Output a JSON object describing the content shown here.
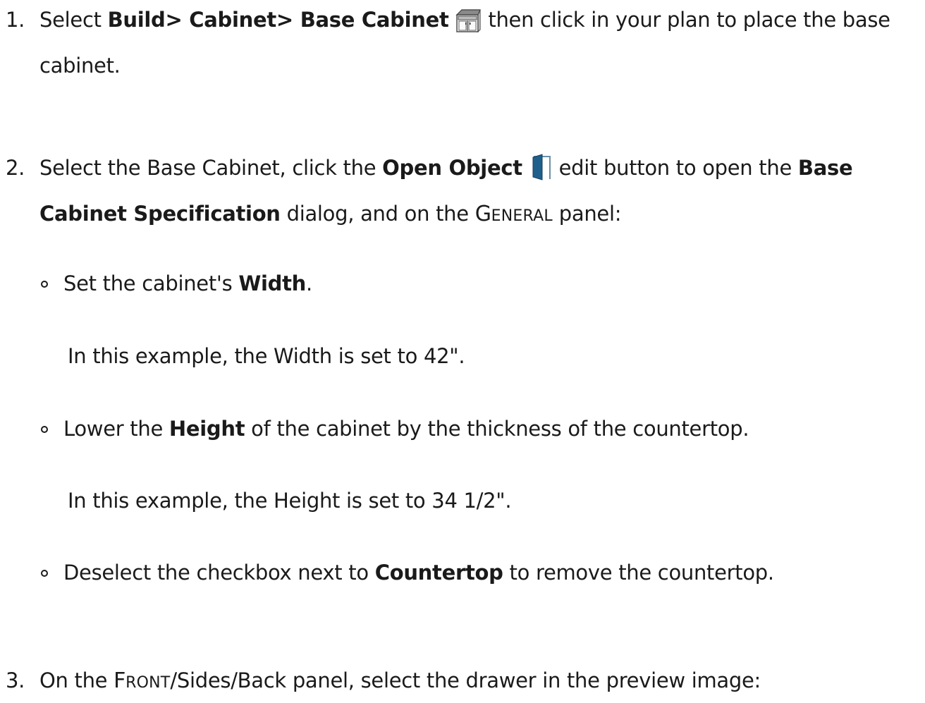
{
  "steps": [
    {
      "number": "1.",
      "text_before": "Select ",
      "menu_path": "Build> Cabinet> Base Cabinet",
      "icon": "base-cabinet-icon",
      "text_after": " then click in your plan to place the base",
      "text_line2": "cabinet."
    },
    {
      "number": "2.",
      "text_before": "Select the Base Cabinet, click the ",
      "button_name": "Open Object",
      "icon": "open-object-icon",
      "text_mid": " edit button to open the ",
      "dialog_name_part1": "Base",
      "dialog_name_part2": "Cabinet Specification",
      "text_after": " dialog, and on the ",
      "panel_cap": "G",
      "panel_rest": "ENERAL",
      "text_end": " panel:",
      "substeps": [
        {
          "text_before": "Set the cabinet's ",
          "bold": "Width",
          "text_after": ".",
          "note": "In this example, the Width is set to 42\"."
        },
        {
          "text_before": "Lower the ",
          "bold": "Height",
          "text_after": " of the cabinet by the thickness of the countertop.",
          "note": "In this example, the Height is set to 34 1/2\"."
        },
        {
          "text_before": "Deselect the checkbox next to ",
          "bold": "Countertop",
          "text_after": " to remove the countertop."
        }
      ]
    },
    {
      "number": "3.",
      "text_before": "On the ",
      "panel_cap": "F",
      "panel_rest": "RONT",
      "panel_suffix": "/Sides/Back",
      "text_after": " panel, select the drawer in the preview image:"
    }
  ],
  "colors": {
    "text": "#1a1a1a",
    "open_object_icon": "#1f5f8b"
  }
}
